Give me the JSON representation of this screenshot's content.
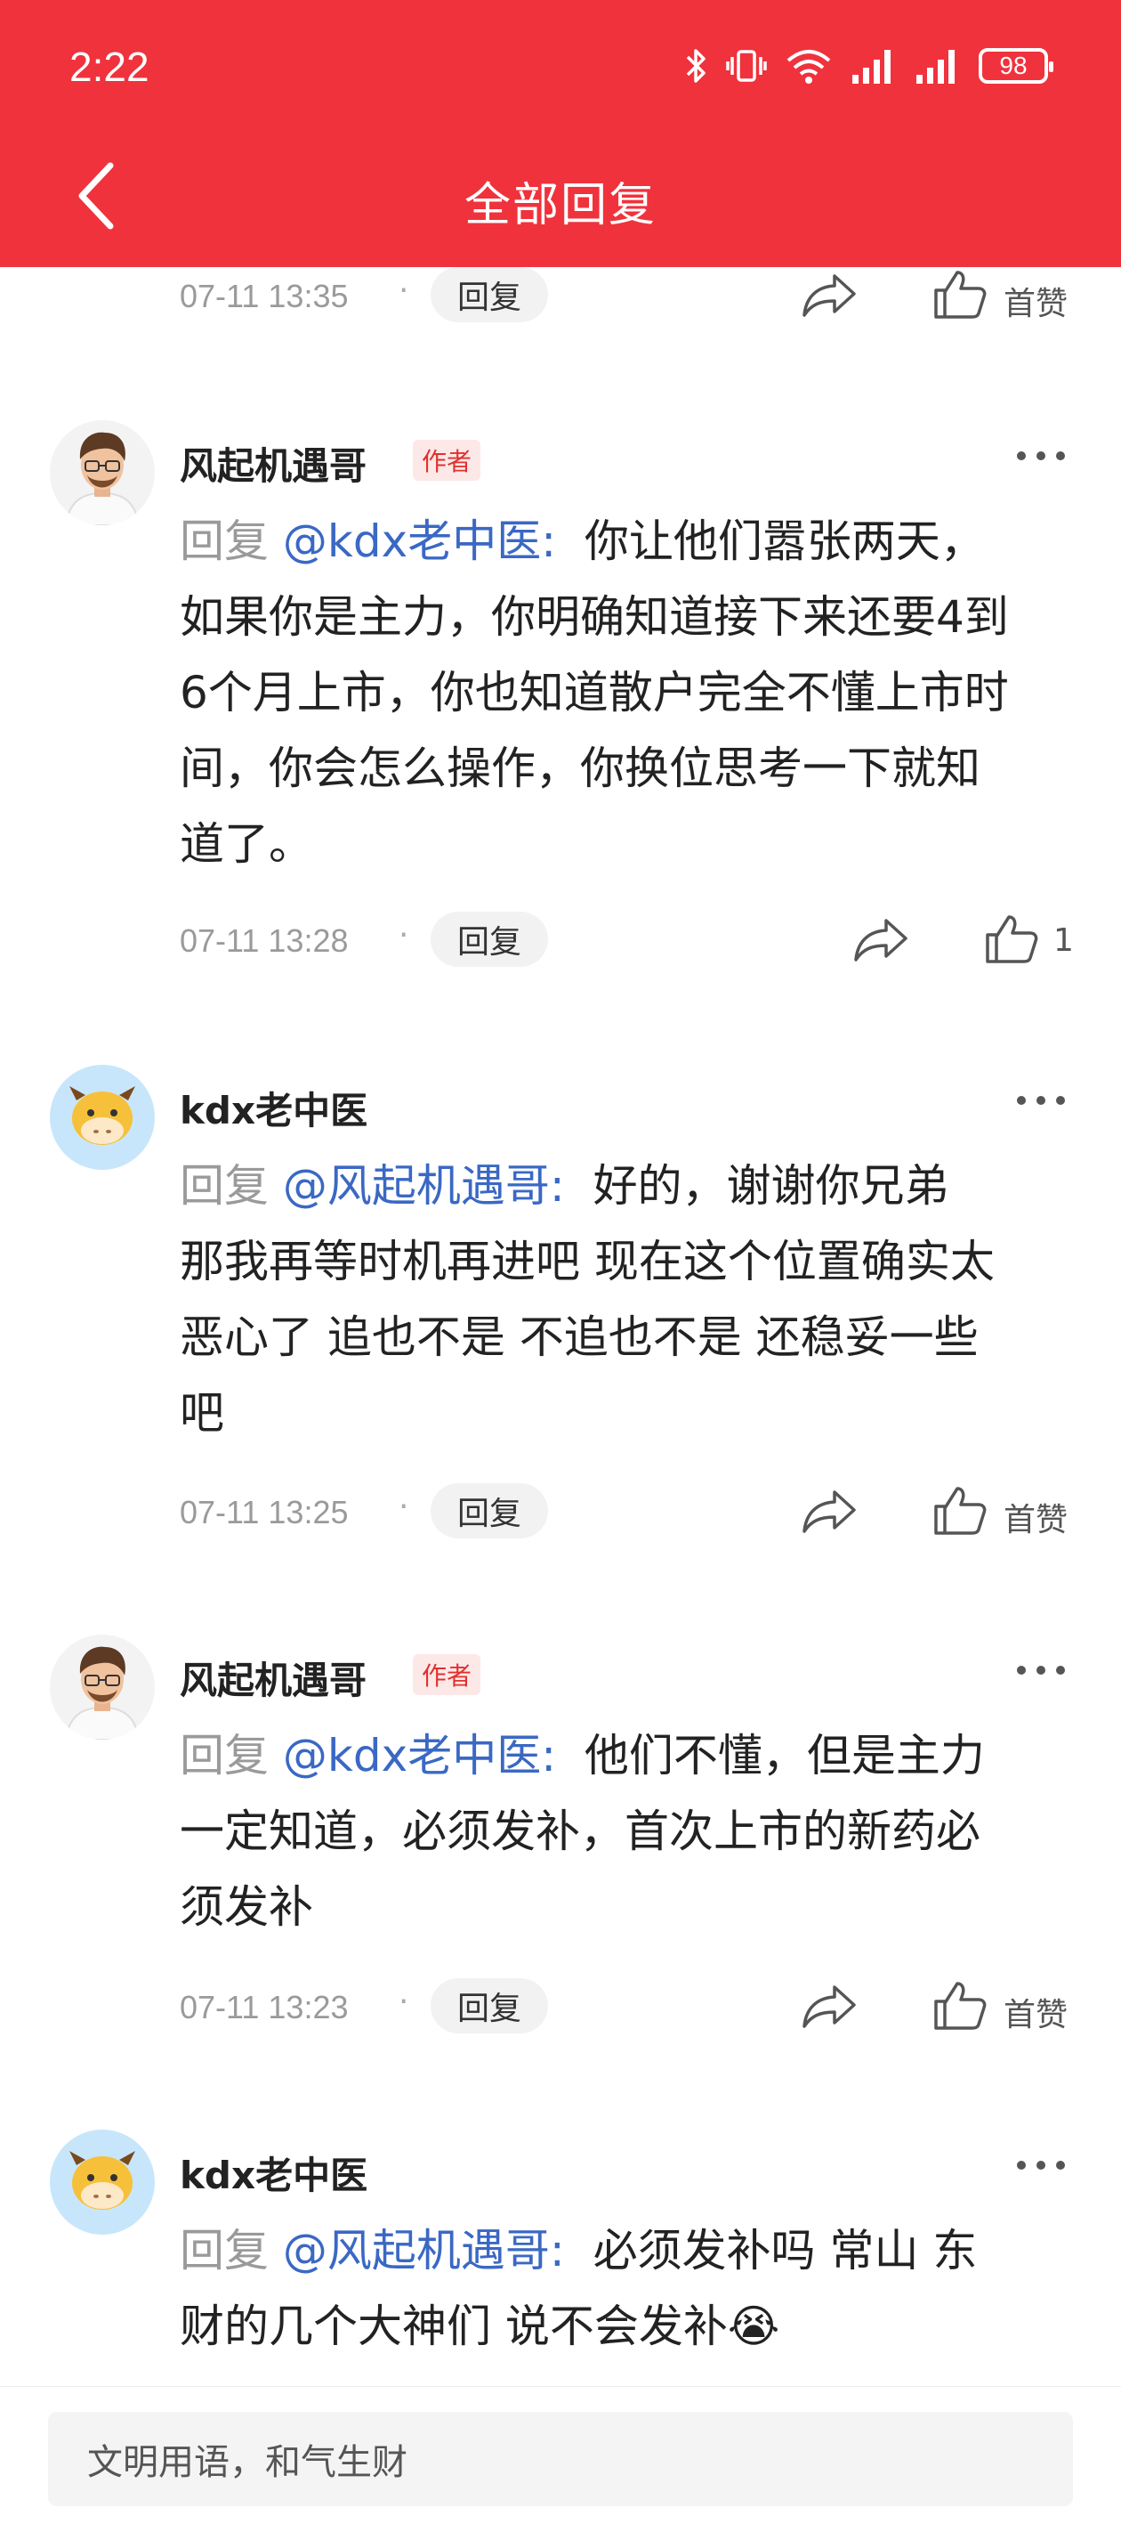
{
  "status_bar": {
    "time": "2:22",
    "battery": "98"
  },
  "header": {
    "title": "全部回复"
  },
  "top_meta": {
    "time": "07-11 13:35",
    "reply_label": "回复",
    "like_label": "首赞"
  },
  "comments": [
    {
      "name": "风起机遇哥",
      "badge": "作者",
      "reply_word": "回复",
      "mention": "@kdx老中医:",
      "lines": [
        "你让他们嚣张两天，",
        "如果你是主力，你明确知道接下来还要4到",
        "6个月上市，你也知道散户完全不懂上市时",
        "间，你会怎么操作，你换位思考一下就知",
        "道了。"
      ],
      "time": "07-11 13:28",
      "reply_label": "回复",
      "like_label": "1"
    },
    {
      "name": "kdx老中医",
      "reply_word": "回复",
      "mention": "@风起机遇哥:",
      "lines": [
        "好的，谢谢你兄弟",
        "那我再等时机再进吧 现在这个位置确实太",
        "恶心了 追也不是 不追也不是 还稳妥一些",
        "吧"
      ],
      "time": "07-11 13:25",
      "reply_label": "回复",
      "like_label": "首赞"
    },
    {
      "name": "风起机遇哥",
      "badge": "作者",
      "reply_word": "回复",
      "mention": "@kdx老中医:",
      "lines": [
        "他们不懂，但是主力",
        "一定知道，必须发补，首次上市的新药必",
        "须发补"
      ],
      "time": "07-11 13:23",
      "reply_label": "回复",
      "like_label": "首赞"
    },
    {
      "name": "kdx老中医",
      "reply_word": "回复",
      "mention": "@风起机遇哥:",
      "lines": [
        "必须发补吗 常山 东",
        "财的几个大神们 说不会发补😭"
      ]
    }
  ],
  "bottom": {
    "input_placeholder": "文明用语，和气生财"
  }
}
